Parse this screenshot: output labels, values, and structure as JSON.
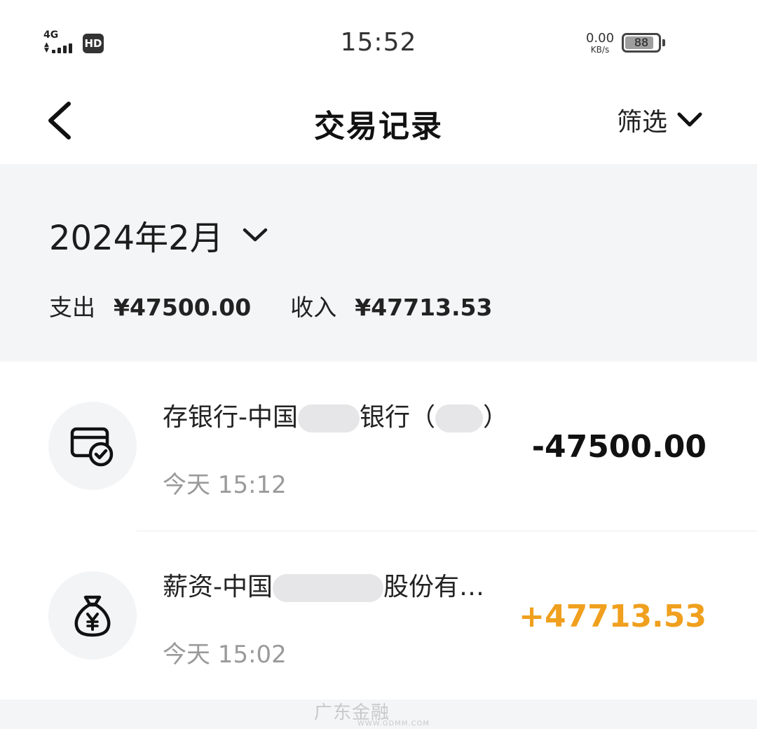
{
  "status_bar": {
    "network": "4G",
    "hd_badge": "HD",
    "time": "15:52",
    "net_speed_value": "0.00",
    "net_speed_unit": "KB/s",
    "battery_level": "88",
    "signal_icon": "signal-bars-icon",
    "battery_icon": "battery-icon"
  },
  "header": {
    "title": "交易记录",
    "filter_label": "筛选",
    "back_icon": "chevron-left-icon",
    "filter_icon": "chevron-down-icon"
  },
  "summary": {
    "month": "2024年2月",
    "expense_label": "支出",
    "expense_amount": "¥47500.00",
    "income_label": "收入",
    "income_amount": "¥47713.53"
  },
  "transactions": [
    {
      "title_prefix": "存银行-中国",
      "title_middle": "银行（",
      "title_suffix": "）",
      "time": "今天 15:12",
      "amount": "-47500.00",
      "amount_color": "#111111",
      "icon": "card-check-icon"
    },
    {
      "title_prefix": "薪资-中国",
      "title_middle": "股份有…",
      "title_suffix": "",
      "time": "今天 15:02",
      "amount": "+47713.53",
      "amount_color": "#f0a01e",
      "icon": "money-bag-yen-icon"
    }
  ],
  "watermark": {
    "brand": "广东金融",
    "url": "WWW.GDMM.COM"
  },
  "colors": {
    "summary_bg": "#f4f5f7",
    "income_accent": "#f0a01e"
  }
}
